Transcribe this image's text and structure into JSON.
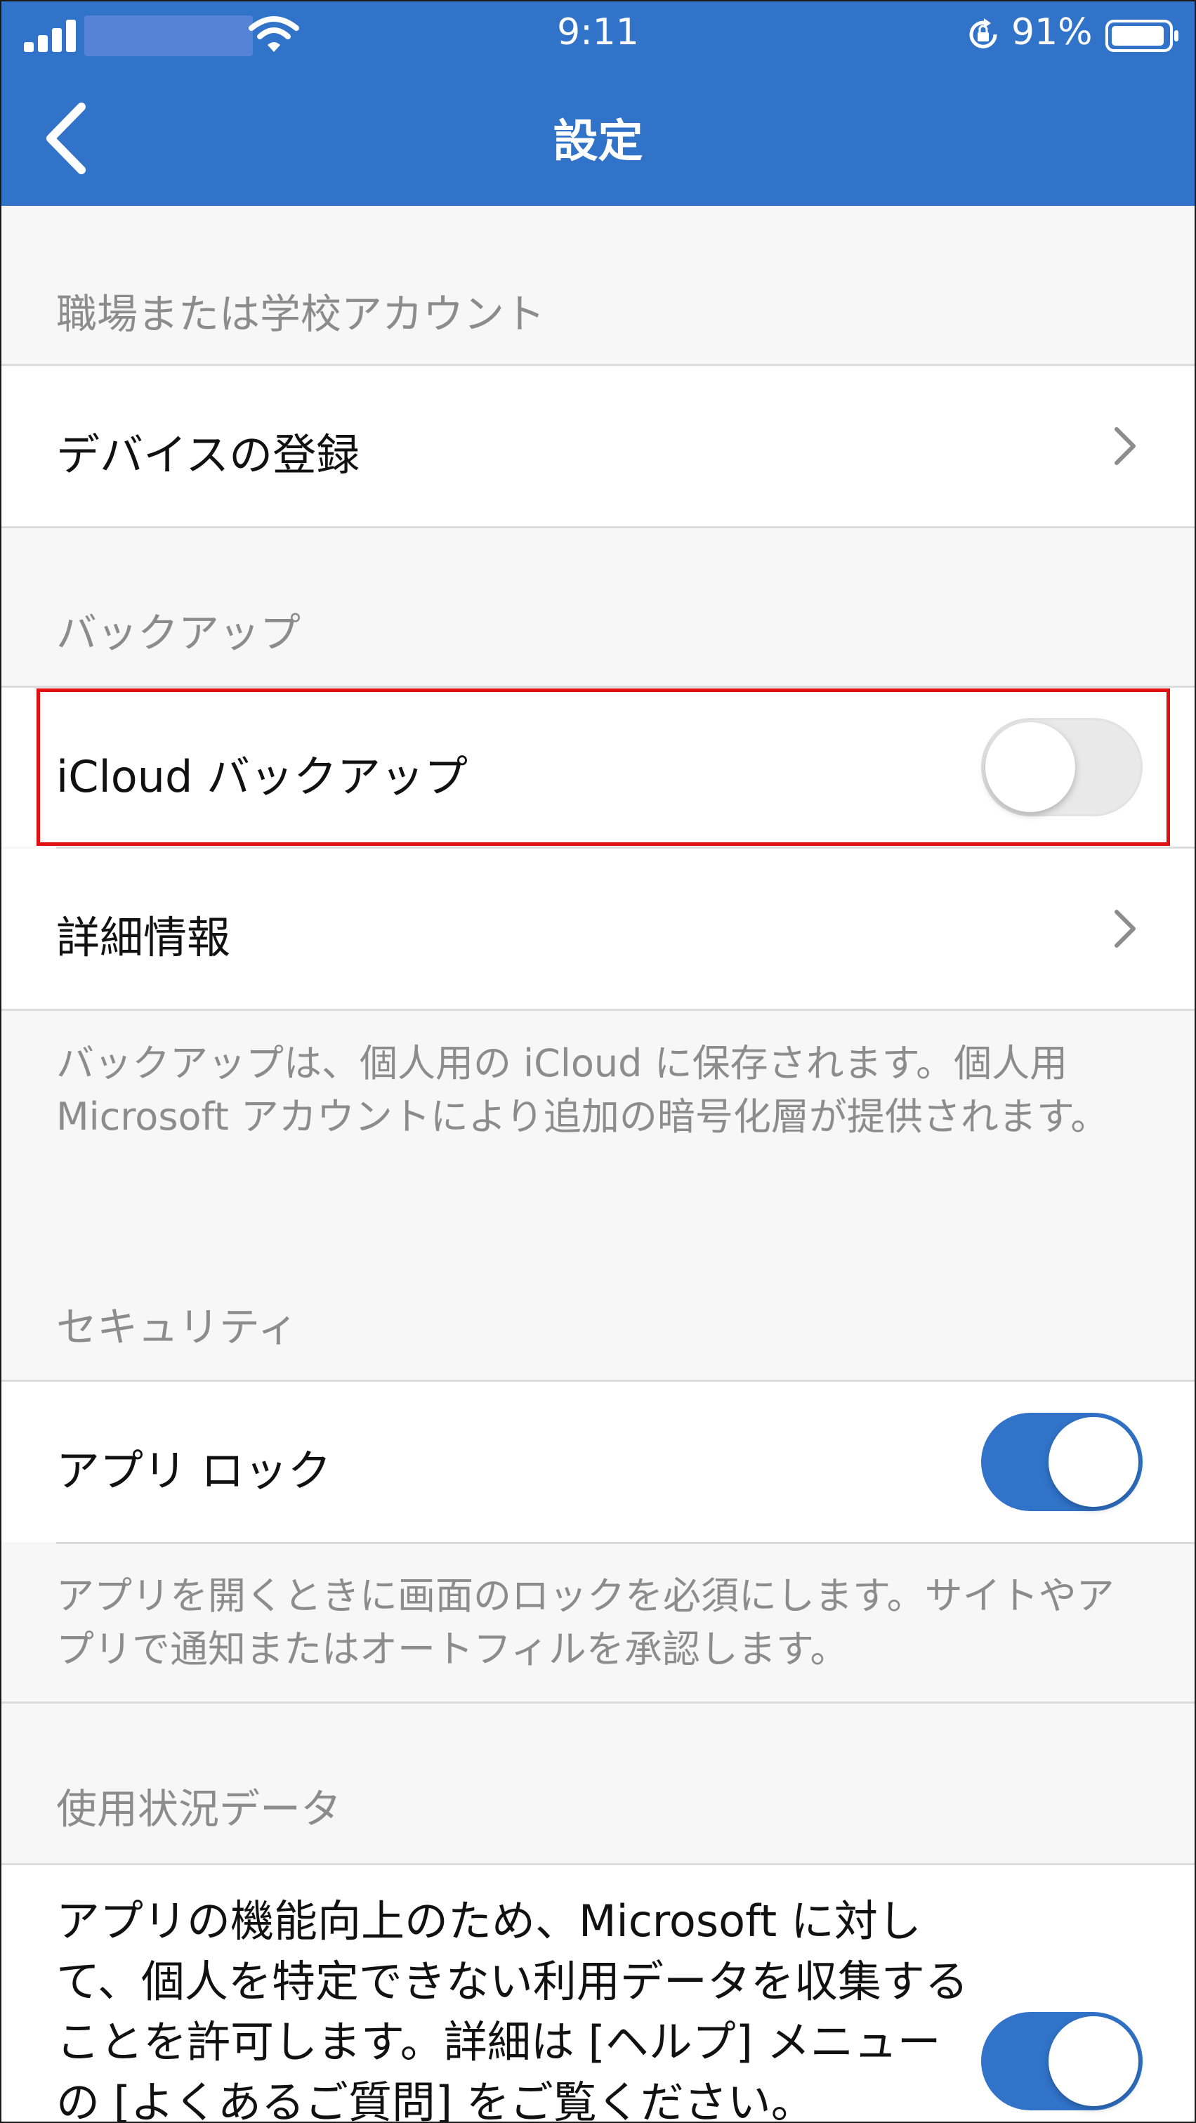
{
  "status_bar": {
    "time": "9:11",
    "battery": "91%"
  },
  "header": {
    "title": "設定"
  },
  "sections": {
    "work_account": {
      "label": "職場または学校アカウント",
      "device_register": "デバイスの登録"
    },
    "backup": {
      "label": "バックアップ",
      "icloud_backup": "iCloud バックアップ",
      "icloud_backup_enabled": false,
      "details": "詳細情報",
      "note": "バックアップは、個人用の iCloud に保存されます。個人用 Microsoft アカウントにより追加の暗号化層が提供されます。"
    },
    "security": {
      "label": "セキュリティ",
      "app_lock": "アプリ ロック",
      "app_lock_enabled": true,
      "note": "アプリを開くときに画面のロックを必須にします。サイトやアプリで通知またはオートフィルを承認します。"
    },
    "usage": {
      "label": "使用状況データ",
      "text": "アプリの機能向上のため、Microsoft に対して、個人を特定できない利用データを収集することを許可します。詳細は [ヘルプ] メニューの [よくあるご質問] をご覧ください。",
      "enabled": true
    }
  },
  "colors": {
    "header_bg": "#3173c9",
    "toggle_on": "#3173c9",
    "highlight": "#e01010"
  }
}
